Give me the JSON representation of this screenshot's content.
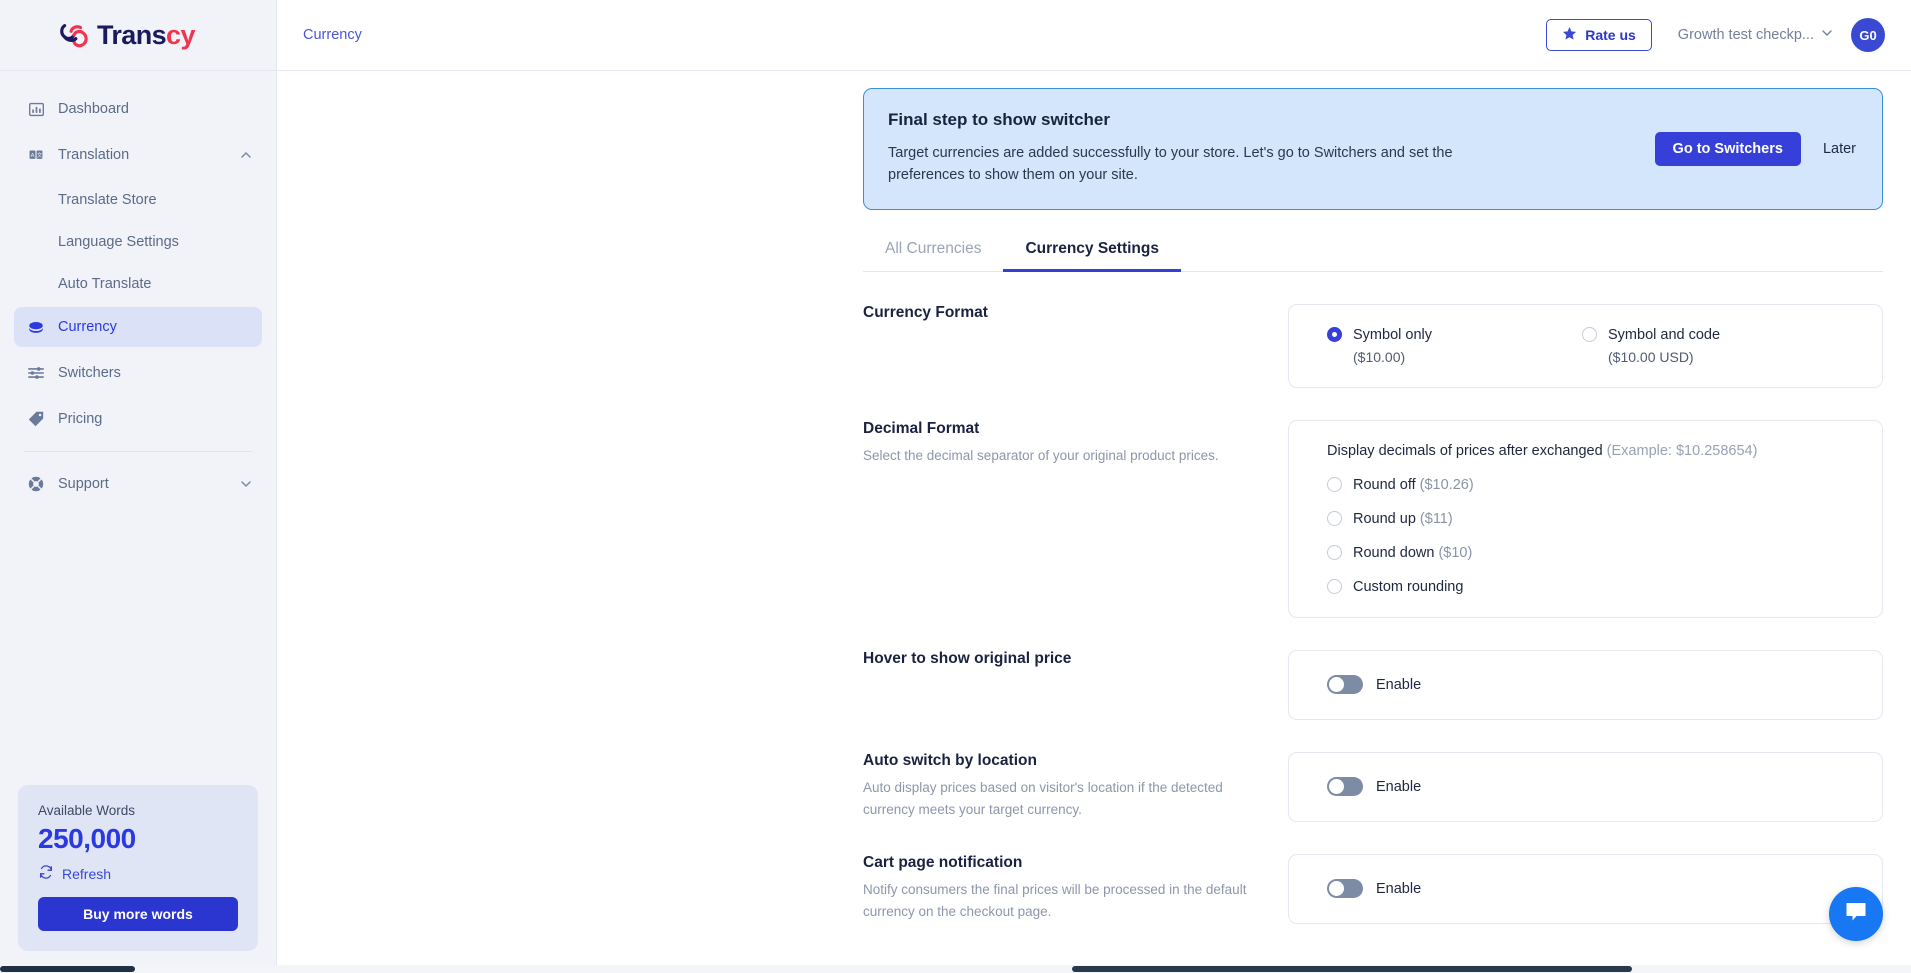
{
  "brand": {
    "name_dark": "Trans",
    "name_accent": "cy",
    "logo_icon": "transcy-knot-logo",
    "accent_color": "#f0364f",
    "primary_color": "#2b35cf"
  },
  "sidebar": {
    "items": [
      {
        "label": "Dashboard",
        "icon": "bar-chart-icon",
        "type": "item",
        "active": false
      },
      {
        "label": "Translation",
        "icon": "translate-icon",
        "type": "group",
        "expanded": true,
        "chevron": "chevron-up-icon"
      },
      {
        "label": "Translate Store",
        "icon": "",
        "type": "sub",
        "active": false
      },
      {
        "label": "Language Settings",
        "icon": "",
        "type": "sub",
        "active": false
      },
      {
        "label": "Auto Translate",
        "icon": "",
        "type": "sub",
        "active": false
      },
      {
        "label": "Currency",
        "icon": "coin-icon",
        "type": "item",
        "active": true
      },
      {
        "label": "Switchers",
        "icon": "sliders-icon",
        "type": "item",
        "active": false
      },
      {
        "label": "Pricing",
        "icon": "tag-icon",
        "type": "item",
        "active": false
      },
      {
        "label": "Support",
        "icon": "lifebuoy-icon",
        "type": "group",
        "expanded": false,
        "chevron": "chevron-down-icon"
      }
    ],
    "words_card": {
      "label": "Available Words",
      "count": "250,000",
      "refresh_label": "Refresh",
      "refresh_icon": "refresh-icon",
      "buy_label": "Buy more words"
    }
  },
  "topbar": {
    "breadcrumb": "Currency",
    "rate_label": "Rate us",
    "rate_icon": "star-icon",
    "store_name": "Growth test checkp...",
    "store_chevron": "chevron-down-icon",
    "avatar_initials": "G0"
  },
  "banner": {
    "title": "Final step to show switcher",
    "body": "Target currencies are added successfully to your store. Let's go to Switchers and set the preferences to show them on your site.",
    "primary_label": "Go to Switchers",
    "secondary_label": "Later"
  },
  "tabs": [
    {
      "label": "All Currencies",
      "active": false
    },
    {
      "label": "Currency Settings",
      "active": true
    }
  ],
  "sections": {
    "currency_format": {
      "title": "Currency Format",
      "options": [
        {
          "label": "Symbol only",
          "example": "($10.00)",
          "checked": true
        },
        {
          "label": "Symbol and code",
          "example": "($10.00 USD)",
          "checked": false
        }
      ]
    },
    "decimal_format": {
      "title": "Decimal Format",
      "desc": "Select the decimal separator of your original product prices.",
      "panel_heading": "Display decimals of prices after exchanged",
      "panel_heading_muted": "(Example: $10.258654)",
      "options": [
        {
          "label": "Round off ",
          "example": "($10.26)",
          "checked": false
        },
        {
          "label": "Round up ",
          "example": "($11)",
          "checked": false
        },
        {
          "label": "Round down ",
          "example": "($10)",
          "checked": false
        },
        {
          "label": "Custom rounding",
          "example": "",
          "checked": false
        }
      ]
    },
    "hover_price": {
      "title": "Hover to show original price",
      "desc": "",
      "toggle_label": "Enable",
      "toggle_on": false
    },
    "auto_switch": {
      "title": "Auto switch by location",
      "desc": "Auto display prices based on visitor's location if the detected currency meets your target currency.",
      "toggle_label": "Enable",
      "toggle_on": false
    },
    "cart_notification": {
      "title": "Cart page notification",
      "desc": "Notify consumers the final prices will be processed in the default currency on the checkout page.",
      "toggle_label": "Enable",
      "toggle_on": false
    }
  },
  "chat_widget": {
    "icon": "chat-bubble-icon",
    "color": "#1877f2"
  }
}
